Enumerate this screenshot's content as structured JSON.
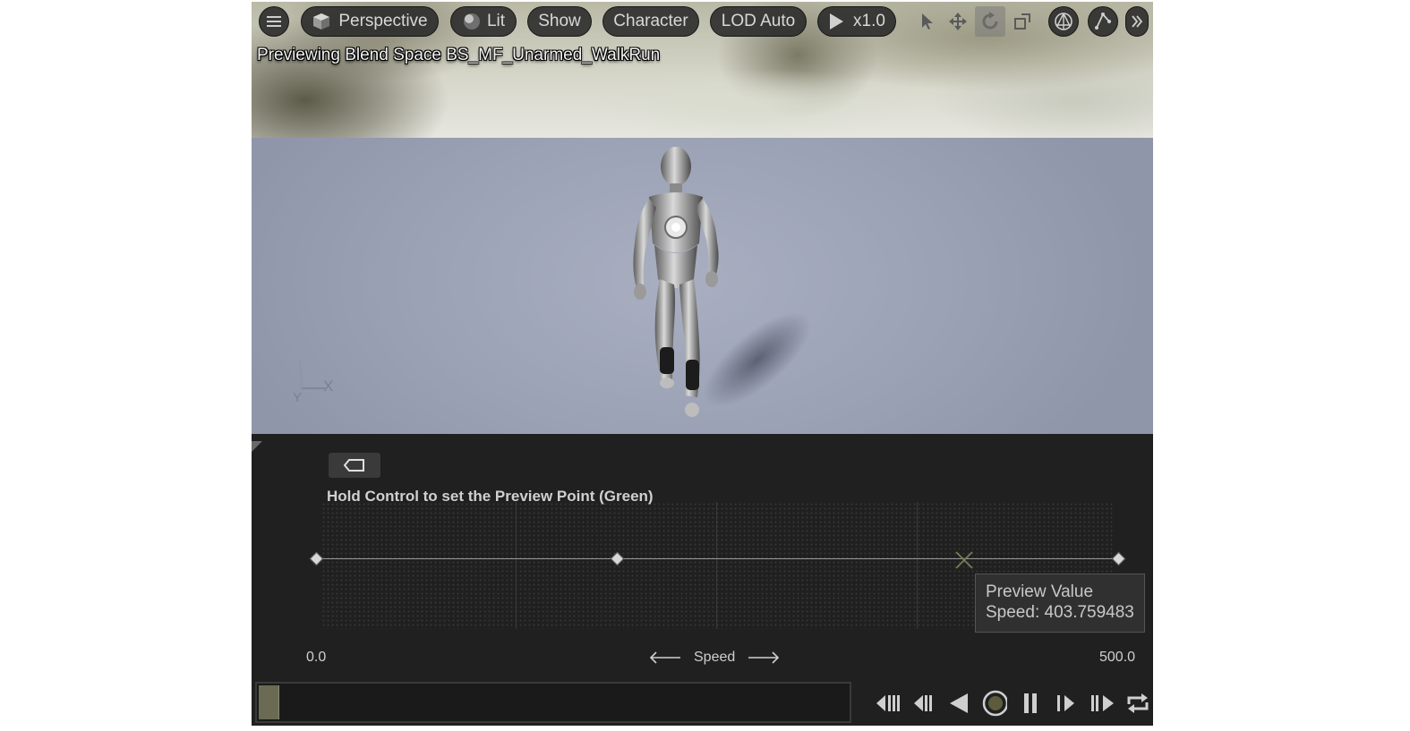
{
  "toolbar": {
    "perspective_label": "Perspective",
    "lit_label": "Lit",
    "show_label": "Show",
    "character_label": "Character",
    "lod_label": "LOD Auto",
    "play_rate_label": "x1.0",
    "icons": [
      "menu-icon",
      "cube-icon",
      "sphere-icon",
      "play-icon",
      "select-icon",
      "translate-icon",
      "rotate-icon",
      "scale-icon",
      "world-local-icon",
      "snap-icon",
      "overflow-chevron-icon"
    ]
  },
  "viewport": {
    "preview_title": "Previewing Blend Space BS_MF_Unarmed_WalkRun",
    "axis_gizmo": {
      "x_label": "X",
      "y_label": "Y"
    }
  },
  "blend_space": {
    "hint": "Hold Control to set the Preview Point (Green)",
    "axis_label": "Speed",
    "axis_min": "0.0",
    "axis_max": "500.0",
    "axis_range": [
      0,
      500
    ],
    "sample_points": [
      0,
      187.5,
      500
    ],
    "preview_speed": 403.759483,
    "tooltip": {
      "title": "Preview Value",
      "value": "Speed: 403.759483"
    }
  },
  "transport": {
    "icons": [
      "skip-to-start-icon",
      "step-back-icon",
      "play-reverse-icon",
      "record-icon",
      "pause-icon",
      "step-forward-icon",
      "skip-to-end-icon",
      "loop-icon"
    ]
  },
  "colors": {
    "panel_bg": "#202020",
    "toolbar_pill": "#282828",
    "floor": "#9aa1b4",
    "scrubber": "#6b6b55"
  }
}
